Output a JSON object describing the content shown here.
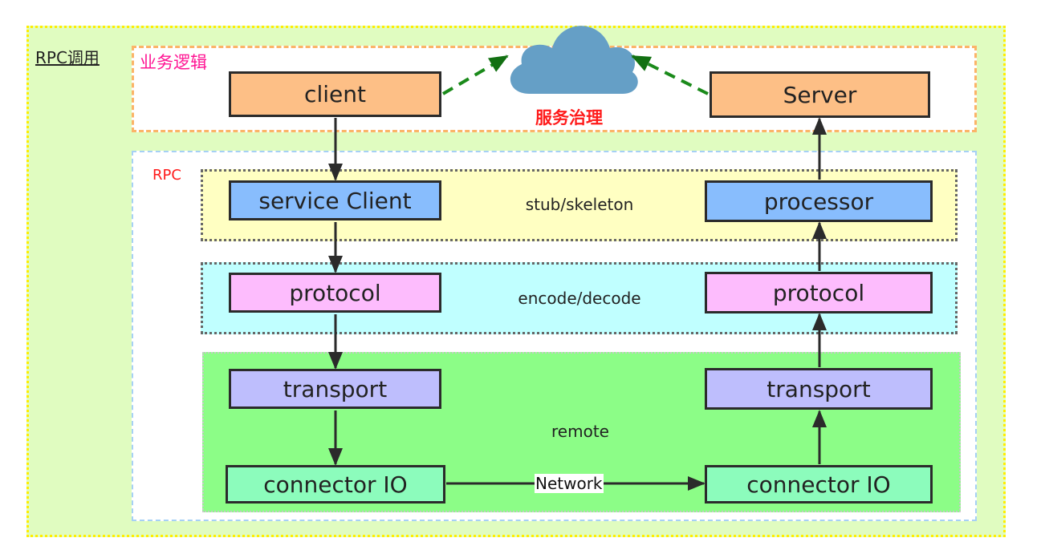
{
  "diagram": {
    "outer_label": "RPC调用",
    "business_label": "业务逻辑",
    "service_governance_label": "服务治理",
    "rpc_label": "RPC",
    "layers": {
      "stub": "stub/skeleton",
      "codec": "encode/decode",
      "remote": "remote"
    },
    "client_side": {
      "client": "client",
      "service_client": "service Client",
      "protocol": "protocol",
      "transport": "transport",
      "connector": "connector IO"
    },
    "server_side": {
      "server": "Server",
      "processor": "processor",
      "protocol": "protocol",
      "transport": "transport",
      "connector": "connector IO"
    },
    "network_label": "Network",
    "colors": {
      "outer_bg": "#e0fcc0",
      "outer_border": "#ffee00",
      "business_border": "#fbb468",
      "rpc_border": "#a6d0f5",
      "stub_bg": "#ffffc2",
      "codec_bg": "#c0ffff",
      "remote_bg": "#8cfd87",
      "client_server_box": "#fdbf86",
      "service_box": "#88bdfd",
      "protocol_box": "#fdbcfd",
      "transport_box": "#bebefd",
      "connector_box": "#8cfcbc",
      "cloud": "#659fc6",
      "governance_arrow": "#1a8a1a"
    }
  }
}
